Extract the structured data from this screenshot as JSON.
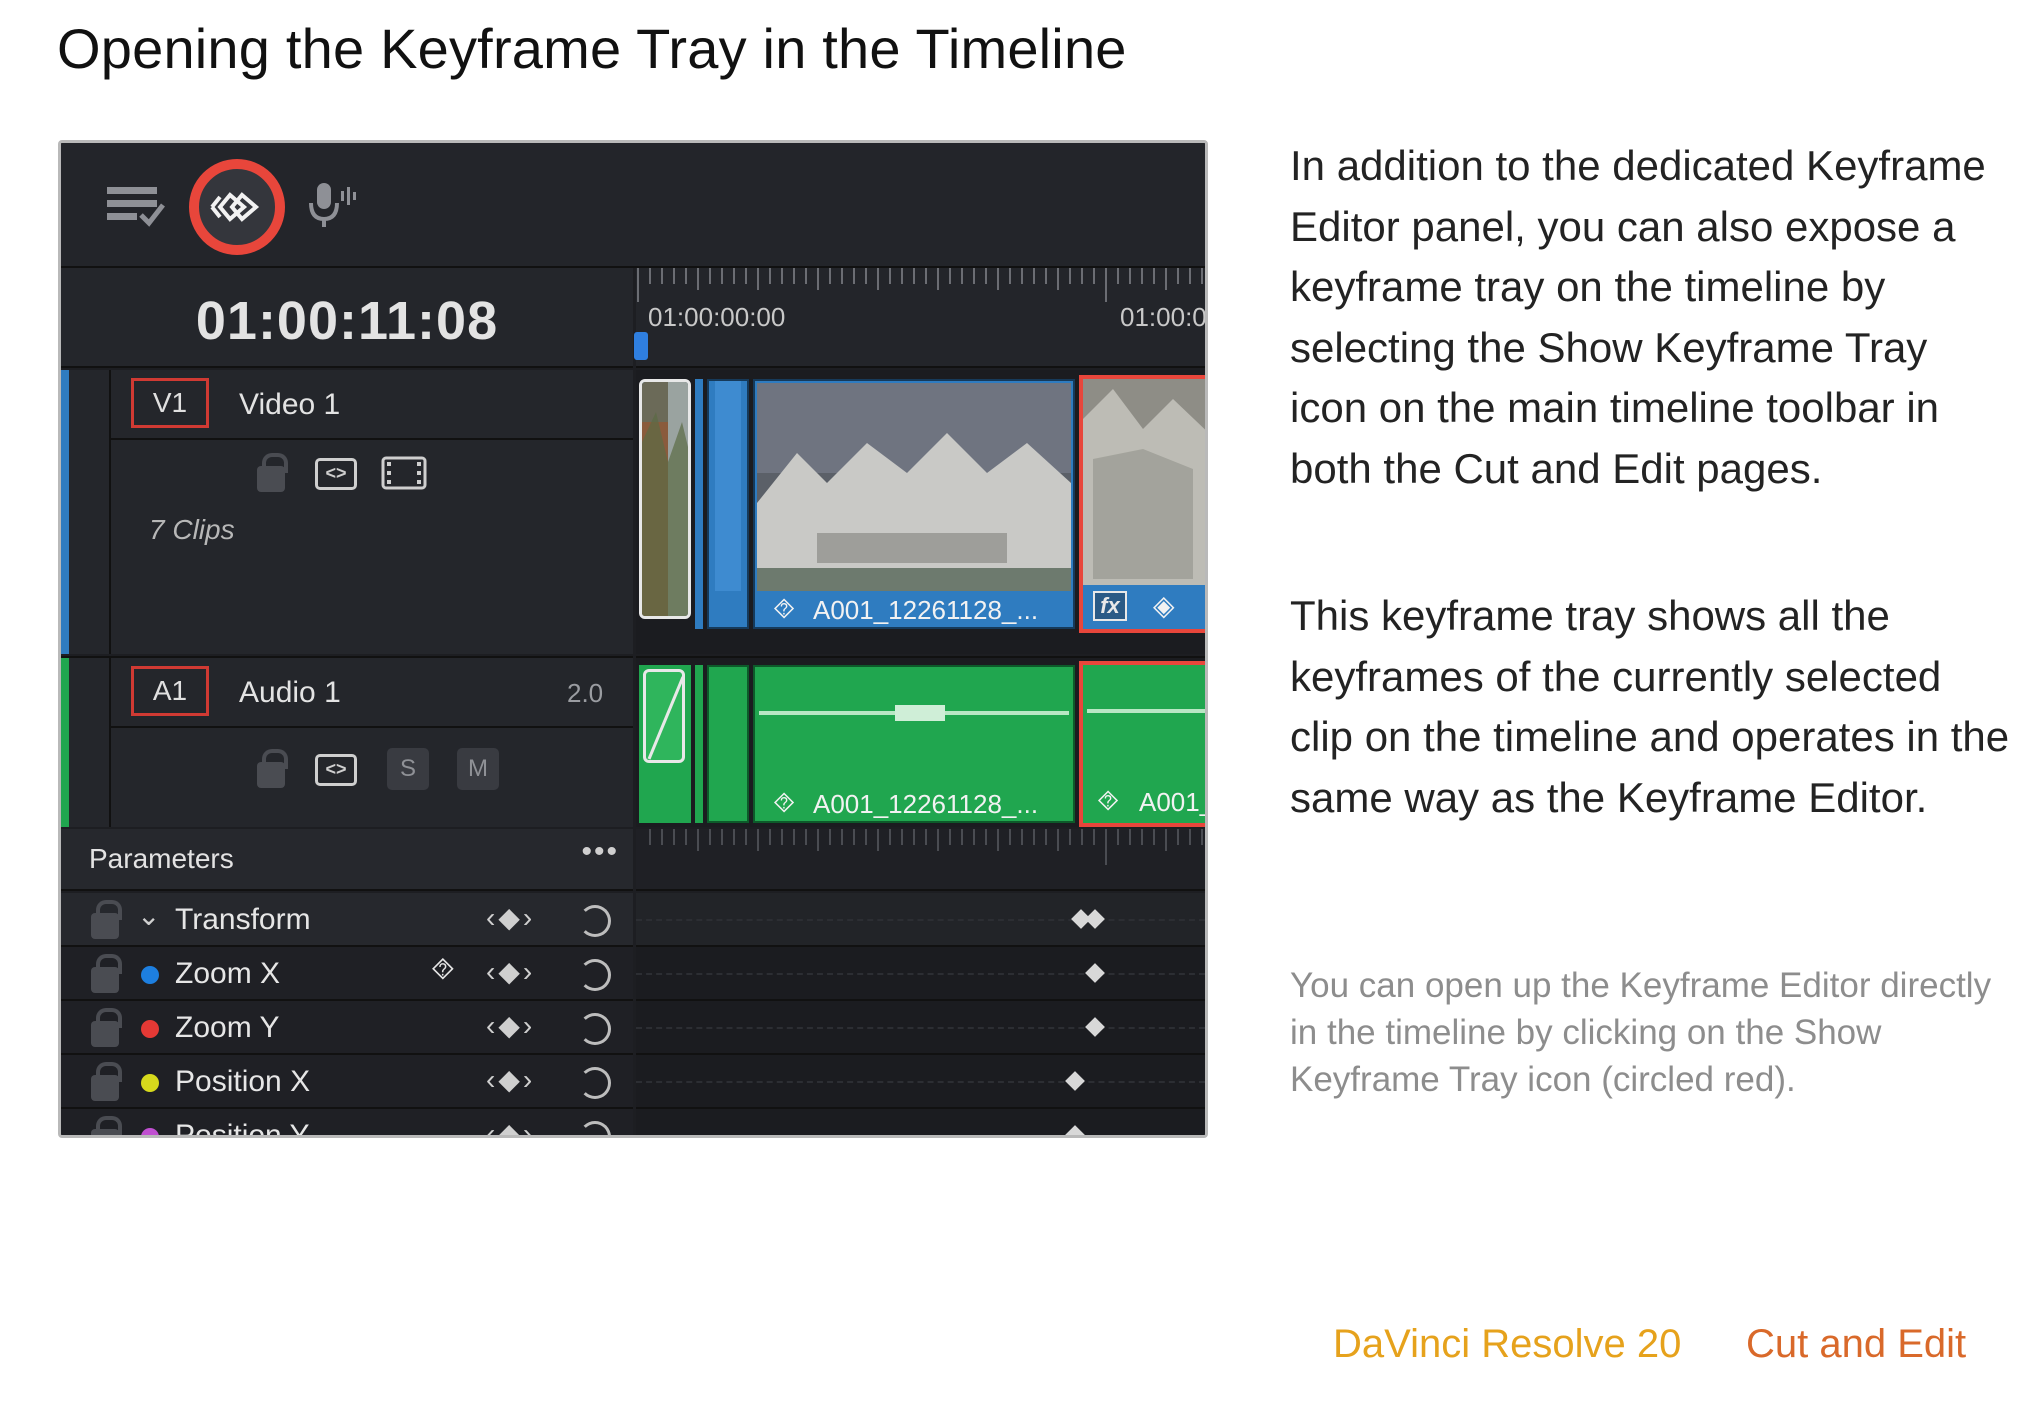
{
  "page": {
    "title": "Opening the Keyframe Tray in the Timeline",
    "paragraphs": [
      "In addition to the dedicated Keyframe Editor panel, you can also expose a keyframe tray on the timeline by selecting the Show Keyframe Tray icon on the main timeline toolbar in both the Cut and Edit pages.",
      "This keyframe tray shows all the keyframes of the currently selected clip on the timeline and operates in the same way as the Keyframe Editor."
    ],
    "caption": "You can open up the Keyframe Editor directly in the timeline by clicking on the Show Keyframe Tray icon (circled red).",
    "footer": {
      "product": "DaVinci Resolve 20",
      "section": "Cut and Edit"
    }
  },
  "screenshot": {
    "toolbar_icons": [
      "timeline-view-options-icon",
      "show-keyframe-tray-icon",
      "voiceover-mic-icon"
    ],
    "timecode": "01:00:11:08",
    "ruler": {
      "start": "01:00:00:00",
      "next": "01:00:0"
    },
    "tracks": [
      {
        "tag": "V1",
        "name": "Video 1",
        "clip_count": "7 Clips",
        "button_icons": [
          "lock-icon",
          "auto-select-icon",
          "film-icon"
        ],
        "color": "#2f7cc0"
      },
      {
        "tag": "A1",
        "name": "Audio 1",
        "channels": "2.0",
        "buttons": [
          "S",
          "M"
        ],
        "color": "#20a64f"
      }
    ],
    "clips": {
      "video_main": "A001_12261128_...",
      "video_fx": "fx",
      "audio_main": "A001_12261128_...",
      "audio_next": "A001_"
    },
    "parameters": {
      "title": "Parameters",
      "menu": "•••",
      "nav": "‹◆›",
      "rows": [
        {
          "name": "Transform",
          "dot": "",
          "group": true
        },
        {
          "name": "Zoom X",
          "dot": "#1d7fe0"
        },
        {
          "name": "Zoom Y",
          "dot": "#e53935"
        },
        {
          "name": "Position X",
          "dot": "#d6d91c"
        },
        {
          "name": "Position Y",
          "dot": "#c04fd1"
        }
      ]
    },
    "accent": "#e8463b"
  }
}
